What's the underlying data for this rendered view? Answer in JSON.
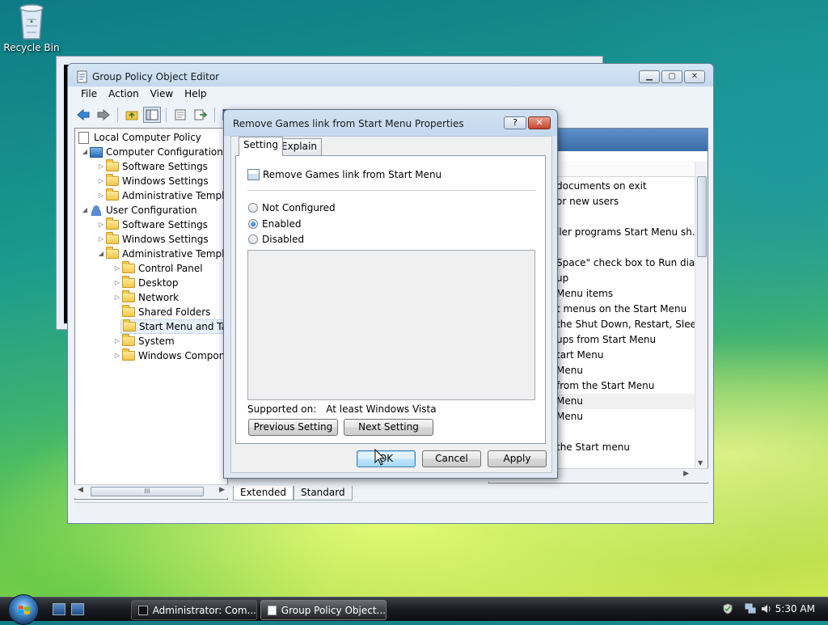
{
  "desktop": {
    "recycle_bin": "Recycle Bin"
  },
  "gpo": {
    "title": "Group Policy Object Editor",
    "menu": [
      "File",
      "Action",
      "View",
      "Help"
    ],
    "tree": [
      "Local Computer Policy",
      "Computer Configuration",
      "Software Settings",
      "Windows Settings",
      "Administrative Templates",
      "User Configuration",
      "Software Settings",
      "Windows Settings",
      "Administrative Templates",
      "Control Panel",
      "Desktop",
      "Network",
      "Shared Folders",
      "Start Menu and Taskbar",
      "System",
      "Windows Components"
    ],
    "right_rows": [
      "documents on exit",
      "or new users",
      "",
      "ller programs Start Menu sh...",
      "",
      "Space\" check box to Run dial...",
      "up",
      "Menu items",
      "t menus on the Start Menu",
      "the Shut Down, Restart, Sleep...",
      "ups from Start Menu",
      "tart Menu",
      "Menu",
      "from the Start Menu",
      "Menu",
      "Menu",
      "",
      "the Start menu"
    ],
    "bottom_tabs": [
      "Extended",
      "Standard"
    ],
    "scroll_glyph": "III"
  },
  "dialog": {
    "title": "Remove Games link from Start Menu Properties",
    "help_glyph": "?",
    "close_glyph": "✕",
    "tabs": [
      "Setting",
      "Explain"
    ],
    "policy_name": "Remove Games link from Start Menu",
    "options": [
      "Not Configured",
      "Enabled",
      "Disabled"
    ],
    "selected_option": "Enabled",
    "supported_label": "Supported on:",
    "supported_value": "At least Windows Vista",
    "prev_button": "Previous Setting",
    "next_button": "Next Setting",
    "ok_button": "OK",
    "cancel_button": "Cancel",
    "apply_button": "Apply"
  },
  "taskbar": {
    "tasks": [
      "Administrator: Com...",
      "Group Policy Object..."
    ],
    "clock": "5:30 AM"
  }
}
